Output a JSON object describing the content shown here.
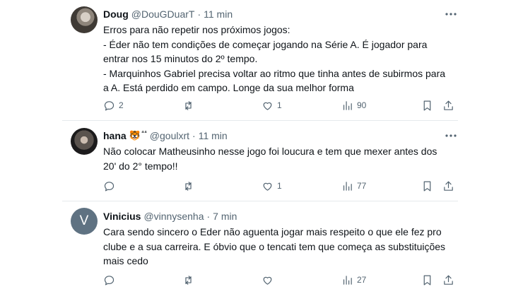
{
  "tweets": [
    {
      "name": "Doug",
      "handle": "@DouGDuarT",
      "separator": "·",
      "time": "11 min",
      "avatar_icon": "user-photo",
      "lines": [
        "Erros para não repetir nos próximos jogos:",
        "- Éder não tem condições de começar jogando na Série A. É jogador para",
        "entrar nos 15 minutos do 2º tempo.",
        "- Marquinhos Gabriel precisa voltar ao ritmo que tinha antes de subirmos para",
        "a A. Está perdido em campo. Longe da sua melhor forma"
      ],
      "stats": {
        "replies": "2",
        "reposts": "",
        "likes": "1",
        "views": "90"
      }
    },
    {
      "name": "hana",
      "emoji": "🐯",
      "emoji_suffix": "⁴⁴",
      "handle": "@goulxrt",
      "separator": "·",
      "time": "11 min",
      "avatar_icon": "user-photo",
      "lines": [
        "Não colocar Matheusinho nesse jogo foi loucura e tem que mexer antes dos",
        "20' do 2° tempo!!"
      ],
      "stats": {
        "replies": "",
        "reposts": "",
        "likes": "1",
        "views": "77"
      }
    },
    {
      "name": "Vinicius",
      "handle": "@vinnysenha",
      "separator": "·",
      "time": "7 min",
      "avatar_letter": "V",
      "lines": [
        "Cara sendo sincero o Eder não aguenta jogar mais respeito o que ele fez pro",
        "clube e a sua carreira. E óbvio que o tencati tem que começa as substituições",
        "mais cedo"
      ],
      "stats": {
        "replies": "",
        "reposts": "",
        "likes": "",
        "views": "27"
      }
    }
  ],
  "icons": [
    "more-icon",
    "reply-icon",
    "repost-icon",
    "like-icon",
    "views-icon",
    "bookmark-icon",
    "share-icon"
  ],
  "colors": {
    "text": "#0f1419",
    "secondary": "#536471",
    "divider": "#e6e9ec",
    "avatar_letter_bg": "#5f7282"
  }
}
